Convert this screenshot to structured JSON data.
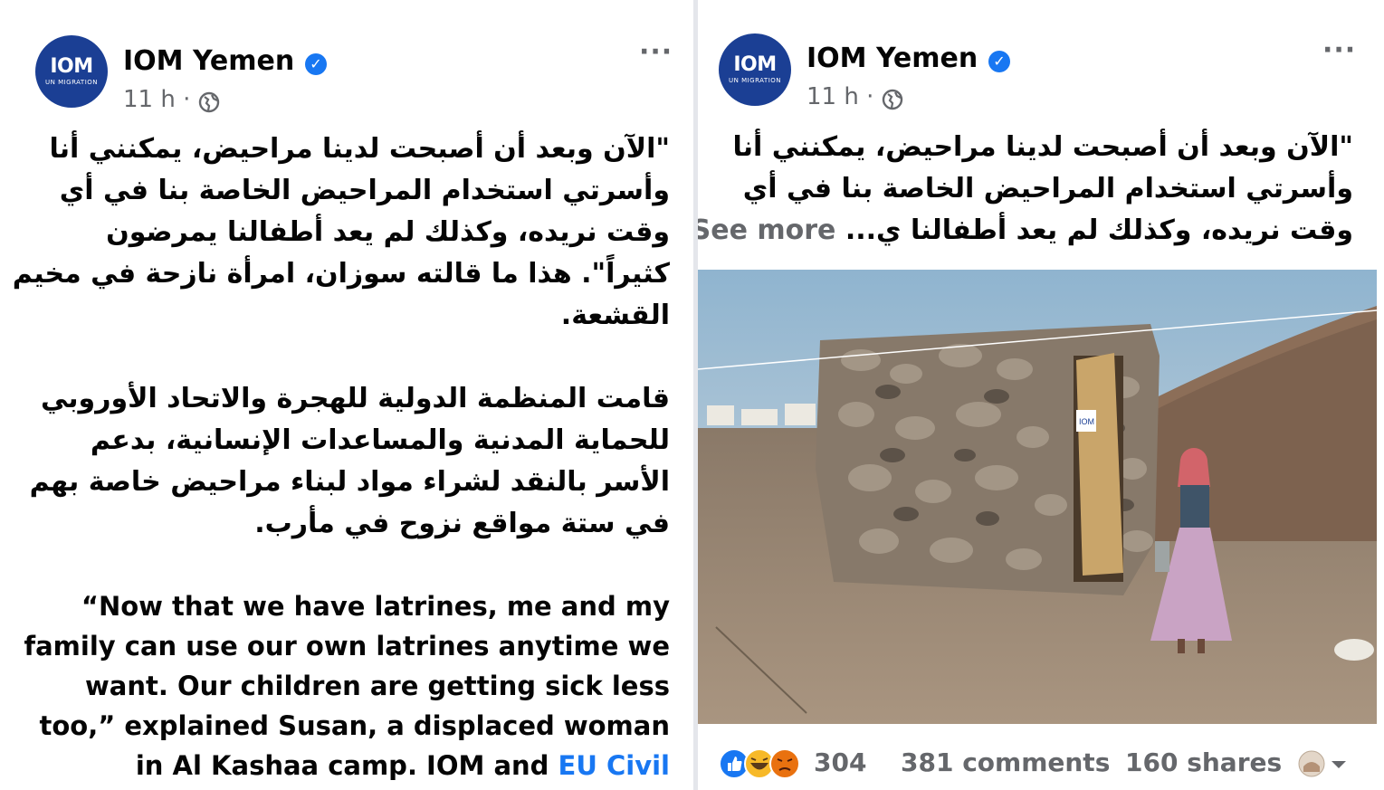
{
  "left_post": {
    "page_name": "IOM Yemen",
    "avatar": {
      "logo_text": "IOM",
      "sub_text": "UN MIGRATION"
    },
    "time": "11 h",
    "separator": "·",
    "privacy_icon": "globe-icon",
    "more_label": "···",
    "arabic_paragraph_1": [
      "\"الآن وبعد أن أصبحت لدينا مراحيض، يمكنني أنا",
      "وأسرتي استخدام المراحيض الخاصة بنا في أي",
      "وقت نريده، وكذلك لم يعد أطفالنا يمرضون",
      "كثيراً\". هذا ما قالته سوزان، امرأة نازحة في مخيم",
      "القشعة."
    ],
    "arabic_paragraph_2": [
      "قامت المنظمة الدولية للهجرة والاتحاد الأوروبي",
      "للحماية المدنية والمساعدات الإنسانية، بدعم",
      "الأسر بالنقد لشراء مواد لبناء مراحيض خاصة بهم",
      "في ستة مواقع نزوح في مأرب."
    ],
    "english_lines": [
      "“Now that we have latrines, me and my",
      "family can use our own latrines anytime we",
      "want. Our children are getting sick less",
      "too,” explained Susan, a displaced woman"
    ],
    "english_last_line_text": "in Al Kashaa camp. IOM and ",
    "english_last_line_link": "EU Civil"
  },
  "right_post": {
    "page_name": "IOM Yemen",
    "avatar": {
      "logo_text": "IOM",
      "sub_text": "UN MIGRATION"
    },
    "time": "11 h",
    "separator": "·",
    "privacy_icon": "globe-icon",
    "more_label": "···",
    "arabic_lines": [
      "\"الآن وبعد أن أصبحت لدينا مراحيض، يمكنني أنا",
      "وأسرتي استخدام المراحيض الخاصة بنا في أي"
    ],
    "arabic_last_line": "وقت نريده، وكذلك لم يعد أطفالنا ي...",
    "see_more": "See more",
    "photo_label": "IOM",
    "reaction_count": "304",
    "comments": "381 comments",
    "shares": "160 shares",
    "reaction_icons": [
      "like-icon",
      "haha-icon",
      "angry-icon"
    ]
  },
  "colors": {
    "brand_blue": "#1877f2",
    "iom_blue": "#1b3f94",
    "secondary_text": "#65676b"
  }
}
